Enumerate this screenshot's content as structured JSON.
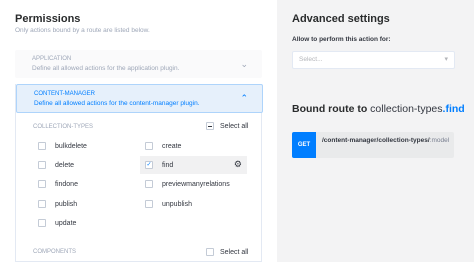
{
  "permissions": {
    "title": "Permissions",
    "subtitle": "Only actions bound by a route are listed below."
  },
  "application_plugin": {
    "name": "APPLICATION",
    "description": "Define all allowed actions for the application plugin."
  },
  "content_manager_plugin": {
    "name": "CONTENT-MANAGER",
    "description": "Define all allowed actions for the content-manager plugin."
  },
  "collection_types": {
    "label": "COLLECTION-TYPES",
    "select_all_label": "Select all",
    "actions": [
      {
        "label": "bulkdelete",
        "checked": false
      },
      {
        "label": "create",
        "checked": false
      },
      {
        "label": "delete",
        "checked": false
      },
      {
        "label": "find",
        "checked": true
      },
      {
        "label": "findone",
        "checked": false
      },
      {
        "label": "previewmanyrelations",
        "checked": false
      },
      {
        "label": "publish",
        "checked": false
      },
      {
        "label": "unpublish",
        "checked": false
      },
      {
        "label": "update",
        "checked": false
      }
    ]
  },
  "components": {
    "label": "COMPONENTS",
    "select_all_label": "Select all"
  },
  "advanced_settings": {
    "title": "Advanced settings",
    "allow_label": "Allow to perform this action for:",
    "select_placeholder": "Select..."
  },
  "bound_route": {
    "title_prefix": "Bound route to ",
    "controller": "collection-types",
    "dot": ".",
    "action": "find",
    "method": "GET",
    "path": "/content-manager/collection-types/",
    "path_param": ":model"
  },
  "colors": {
    "accent": "#007eff",
    "active_bg": "#e6f0fb",
    "sidebar_bg": "#f3f3f4"
  }
}
